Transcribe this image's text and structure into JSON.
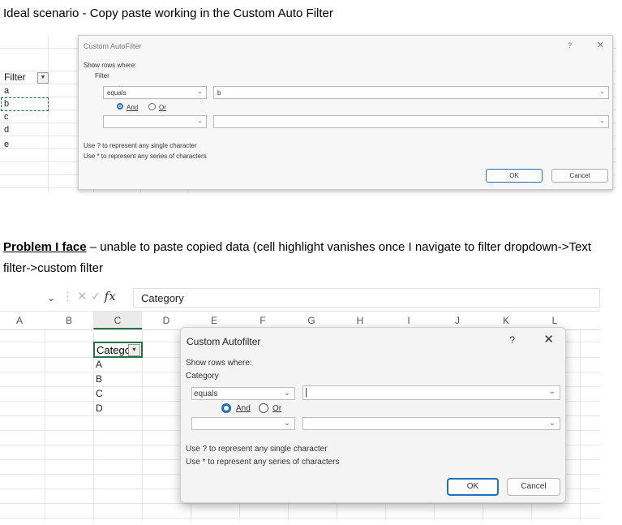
{
  "heading1": "Ideal scenario - Copy paste working in the Custom Auto Filter",
  "problem": {
    "lead": "Problem I face",
    "text": " – unable to paste copied data (cell highlight vanishes once I navigate to filter dropdown->Text filter->custom filter"
  },
  "sheet1": {
    "header": "Filter",
    "cells": [
      "a",
      "b",
      "c",
      "d",
      "e"
    ]
  },
  "dialog1": {
    "title": "Custom AutoFilter",
    "help": "?",
    "close": "✕",
    "show_rows": "Show rows where:",
    "field": "Filter",
    "op1": "equals",
    "val1": "b",
    "and": "And",
    "or": "Or",
    "op2": "",
    "val2": "",
    "hint1": "Use ? to represent any single character",
    "hint2": "Use * to represent any series of characters",
    "ok": "OK",
    "cancel": "Cancel"
  },
  "sheet2": {
    "formula": "Category",
    "fx": "fx",
    "columns": [
      "A",
      "B",
      "C",
      "D",
      "E",
      "F",
      "G",
      "H",
      "I",
      "J",
      "K",
      "L"
    ],
    "header_cell": "Categor",
    "cells": [
      "A",
      "B",
      "C",
      "D"
    ]
  },
  "dialog2": {
    "title": "Custom Autofilter",
    "help": "?",
    "close": "✕",
    "show_rows": "Show rows where:",
    "field": "Category",
    "op1": "equals",
    "val1": "",
    "and": "And",
    "or": "Or",
    "op2": "",
    "val2": "",
    "hint1": "Use ? to represent any single character",
    "hint2": "Use * to represent any series of characters",
    "ok": "OK",
    "cancel": "Cancel"
  }
}
